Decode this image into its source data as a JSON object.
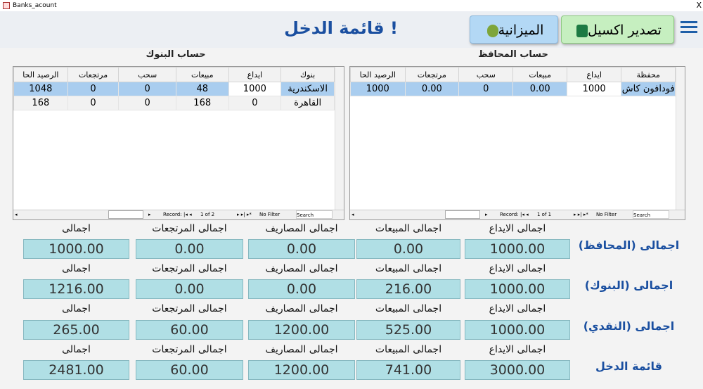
{
  "window": {
    "title": "Banks_acount",
    "close": "X"
  },
  "header": {
    "title": "قائمة الدخل !",
    "export_label": "تصدير اكسيل",
    "budget_label": "الميزانية"
  },
  "banks": {
    "title": "حساب البنوك",
    "columns": [
      "بنوك",
      "ايداع",
      "مبيعات",
      "سحب",
      "مرتجعات",
      "الرصيد الحا"
    ],
    "rows": [
      [
        "الاسكندرية",
        "1000",
        "48",
        "0",
        "0",
        "1048"
      ],
      [
        "القاهرة",
        "0",
        "168",
        "0",
        "0",
        "168"
      ]
    ],
    "nav": {
      "record": "Record:",
      "position": "1 of 2",
      "filter": "No Filter",
      "search": "Search"
    }
  },
  "wallets": {
    "title": "حساب المحافظ",
    "columns": [
      "محفظة",
      "ايداع",
      "مبيعات",
      "سحب",
      "مرتجعات",
      "الرصيد الحا"
    ],
    "rows": [
      [
        "فودافون كاش",
        "1000",
        "0.00",
        "0",
        "0.00",
        "1000"
      ]
    ],
    "nav": {
      "record": "Record:",
      "position": "1 of 1",
      "filter": "No Filter",
      "search": "Search"
    }
  },
  "summary": {
    "labels": [
      "اجمالى الايداع",
      "اجمالى المبيعات",
      "اجمالى المصاريف",
      "اجمالى المرتجعات",
      "اجمالى"
    ],
    "rows": [
      {
        "title": "اجمالى (المحافظ)",
        "values": [
          "1000.00",
          "0.00",
          "0.00",
          "0.00",
          "1000.00"
        ]
      },
      {
        "title": "اجمالى (البنوك)",
        "values": [
          "1000.00",
          "216.00",
          "0.00",
          "0.00",
          "1216.00"
        ]
      },
      {
        "title": "اجمالى (النقدي)",
        "values": [
          "1000.00",
          "525.00",
          "1200.00",
          "60.00",
          "265.00"
        ]
      },
      {
        "title": "قائمة الدخل",
        "values": [
          "3000.00",
          "741.00",
          "1200.00",
          "60.00",
          "2481.00"
        ]
      }
    ]
  },
  "colors": {
    "accent": "#1a4fa0",
    "box": "#b0dfe5",
    "selected_row": "#a9cdef"
  }
}
